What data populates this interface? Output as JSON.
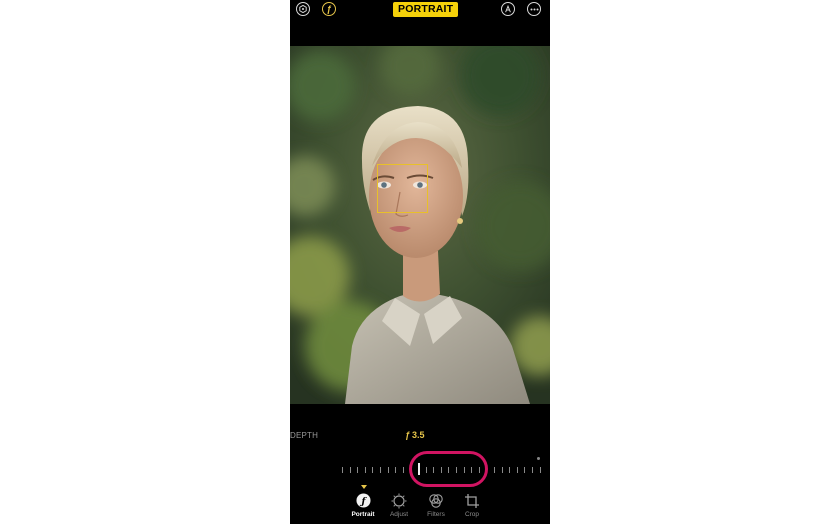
{
  "header": {
    "mode_label": "PORTRAIT",
    "left_icons": [
      "lighting-hexagon-icon",
      "aperture-f-icon"
    ],
    "right_icons": [
      "auto-markup-icon",
      "more-icon"
    ]
  },
  "depth": {
    "label": "DEPTH",
    "fstop_symbol": "ƒ",
    "fstop_value": "3.5"
  },
  "tabs": [
    {
      "label": "Portrait",
      "icon": "portrait-f-icon",
      "active": true
    },
    {
      "label": "Adjust",
      "icon": "adjust-dial-icon",
      "active": false
    },
    {
      "label": "Filters",
      "icon": "filters-circles-icon",
      "active": false
    },
    {
      "label": "Crop",
      "icon": "crop-icon",
      "active": false
    }
  ],
  "colors": {
    "accent": "#f5d10a",
    "focus_box": "#e8c02a",
    "highlight_ring": "#d11462",
    "background": "#000000"
  }
}
